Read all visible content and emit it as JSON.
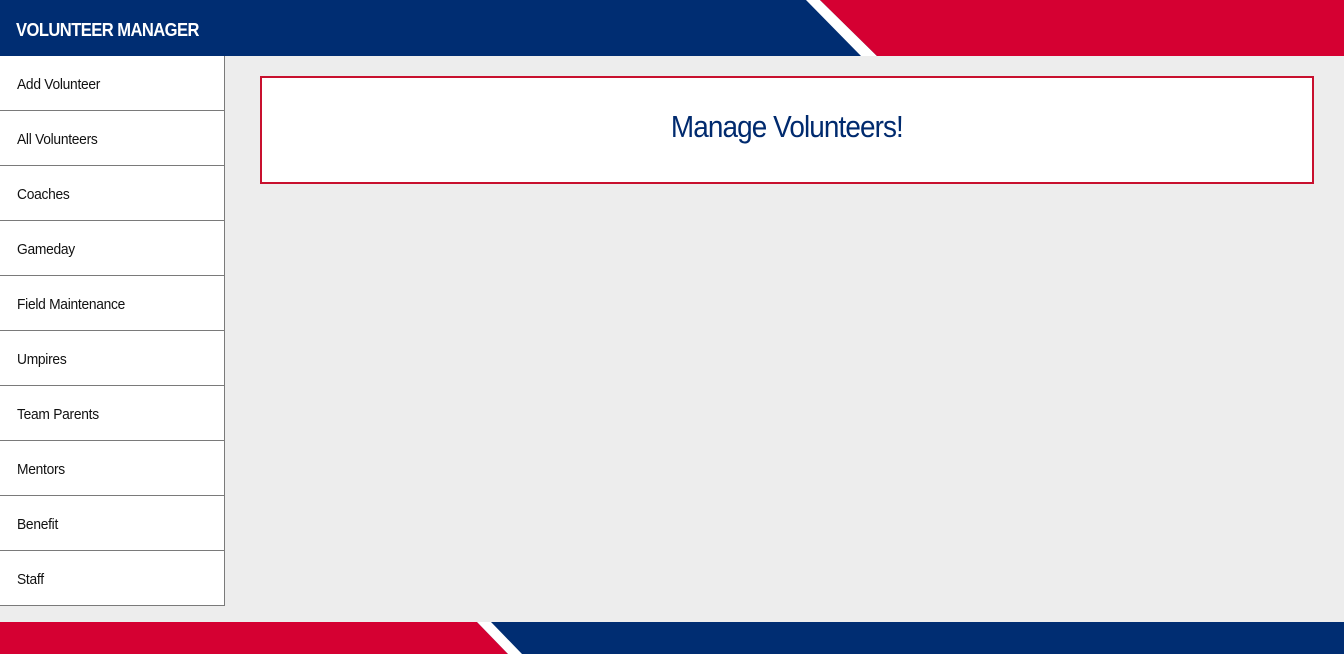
{
  "header": {
    "title": "VOLUNTEER MANAGER"
  },
  "sidebar": {
    "items": [
      {
        "label": "Add Volunteer"
      },
      {
        "label": "All Volunteers"
      },
      {
        "label": "Coaches"
      },
      {
        "label": "Gameday"
      },
      {
        "label": "Field Maintenance"
      },
      {
        "label": "Umpires"
      },
      {
        "label": "Team Parents"
      },
      {
        "label": "Mentors"
      },
      {
        "label": "Benefit"
      },
      {
        "label": "Staff"
      }
    ]
  },
  "main": {
    "banner_title": "Manage Volunteers!"
  },
  "colors": {
    "navy": "#002d72",
    "red": "#d50032",
    "background": "#ededed",
    "border_red": "#c8102e"
  }
}
